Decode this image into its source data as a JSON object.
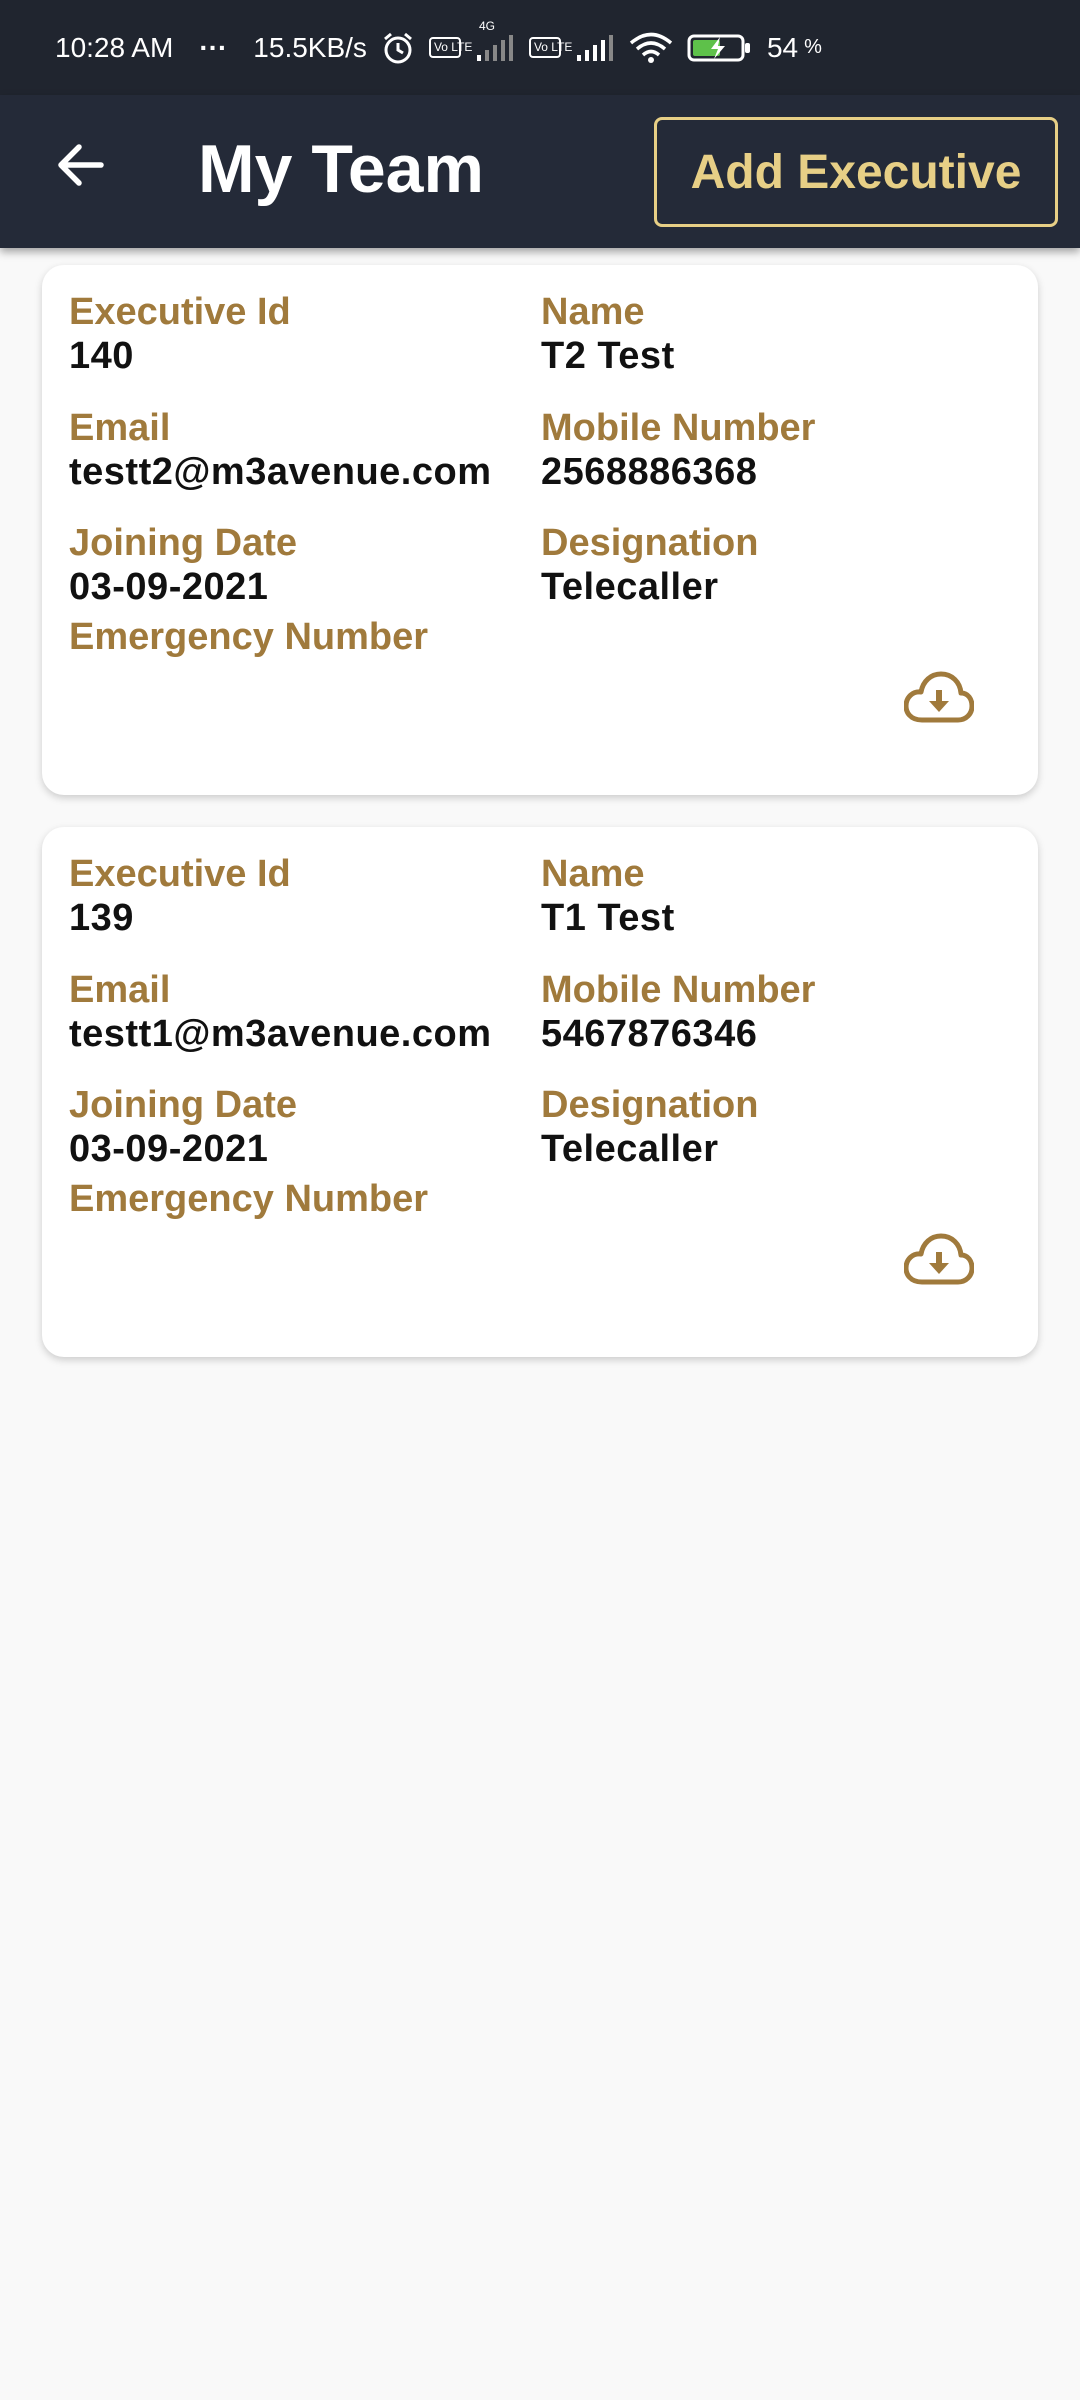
{
  "status_bar": {
    "time": "10:28 AM",
    "dots": "···",
    "speed": "15.5KB/s",
    "network_tag": "4G",
    "volte_1": "Vo LTE",
    "volte_2": "Vo LTE",
    "battery": "54",
    "battery_unit": "%",
    "icons": [
      "alarm-icon",
      "volte-icon",
      "signal-icon",
      "volte-icon",
      "signal-icon",
      "wifi-icon",
      "battery-charging-icon"
    ]
  },
  "header": {
    "back_icon": "arrow-left-icon",
    "title": "My Team",
    "add_button": "Add Executive"
  },
  "colors": {
    "app_bar": "#242a38",
    "status_bar": "#20252f",
    "label_gold": "#a07a3c",
    "button_gold": "#e7cf86",
    "background": "#f9f9f9"
  },
  "executives": [
    {
      "id_label": "Executive Id",
      "id": "140",
      "name_label": "Name",
      "name": "T2 Test",
      "email_label": "Email",
      "email": "testt2@m3avenue.com",
      "mobile_label": "Mobile Number",
      "mobile": "2568886368",
      "joining_label": "Joining Date",
      "joining": "03-09-2021",
      "designation_label": "Designation",
      "designation": "Telecaller",
      "emergency_label": "Emergency Number",
      "emergency": "",
      "download_icon": "cloud-download-icon"
    },
    {
      "id_label": "Executive Id",
      "id": "139",
      "name_label": "Name",
      "name": "T1 Test",
      "email_label": "Email",
      "email": "testt1@m3avenue.com",
      "mobile_label": "Mobile Number",
      "mobile": "5467876346",
      "joining_label": "Joining Date",
      "joining": "03-09-2021",
      "designation_label": "Designation",
      "designation": "Telecaller",
      "emergency_label": "Emergency Number",
      "emergency": "",
      "download_icon": "cloud-download-icon"
    }
  ]
}
